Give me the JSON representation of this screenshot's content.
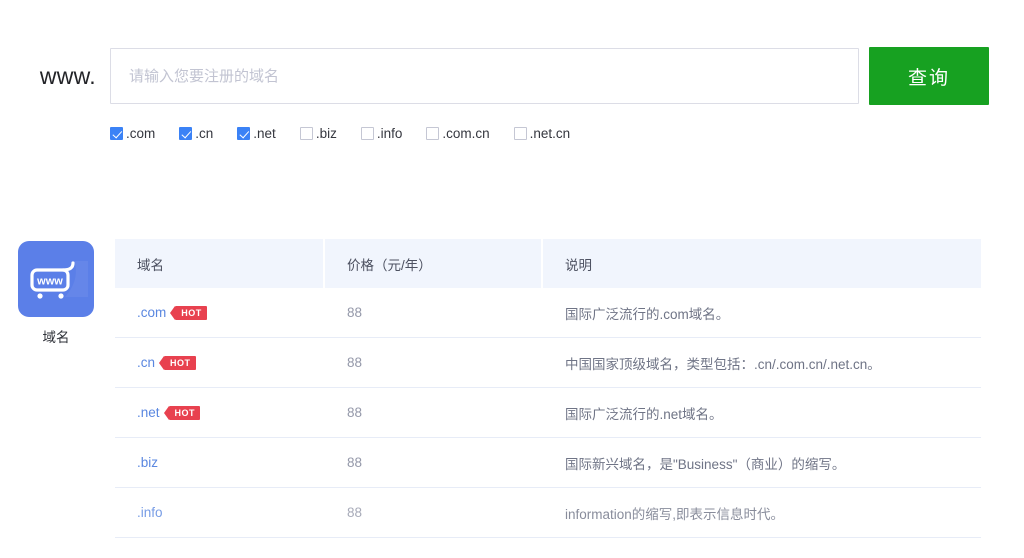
{
  "search": {
    "prefix_label": "www.",
    "placeholder": "请输入您要注册的域名",
    "value": "",
    "button_label": "查询",
    "button_color": "#17a121"
  },
  "suffixes": [
    {
      "label": ".com",
      "checked": true
    },
    {
      "label": ".cn",
      "checked": true
    },
    {
      "label": ".net",
      "checked": true
    },
    {
      "label": ".biz",
      "checked": false
    },
    {
      "label": ".info",
      "checked": false
    },
    {
      "label": ".com.cn",
      "checked": false
    },
    {
      "label": ".net.cn",
      "checked": false
    }
  ],
  "category": {
    "icon": "www-cart-icon",
    "label": "域名",
    "tile_color": "#5b7fe8"
  },
  "table": {
    "headers": [
      "域名",
      "价格（元/年）",
      "说明"
    ],
    "rows": [
      {
        "name": ".com",
        "badge": "HOT",
        "price": "88",
        "desc": "国际广泛流行的.com域名。"
      },
      {
        "name": ".cn",
        "badge": "HOT",
        "price": "88",
        "desc": "中国国家顶级域名，类型包括：.cn/.com.cn/.net.cn。"
      },
      {
        "name": ".net",
        "badge": "HOT",
        "price": "88",
        "desc": "国际广泛流行的.net域名。"
      },
      {
        "name": ".biz",
        "badge": "",
        "price": "88",
        "desc": "国际新兴域名，是\"Business\"（商业）的缩写。"
      },
      {
        "name": ".info",
        "badge": "",
        "price": "88",
        "desc": "information的缩写,即表示信息时代。"
      }
    ]
  },
  "colors": {
    "link": "#5a87e0",
    "badge": "#e8414f",
    "header_bg": "#f1f5fd",
    "checkbox_checked": "#3b82f6"
  }
}
